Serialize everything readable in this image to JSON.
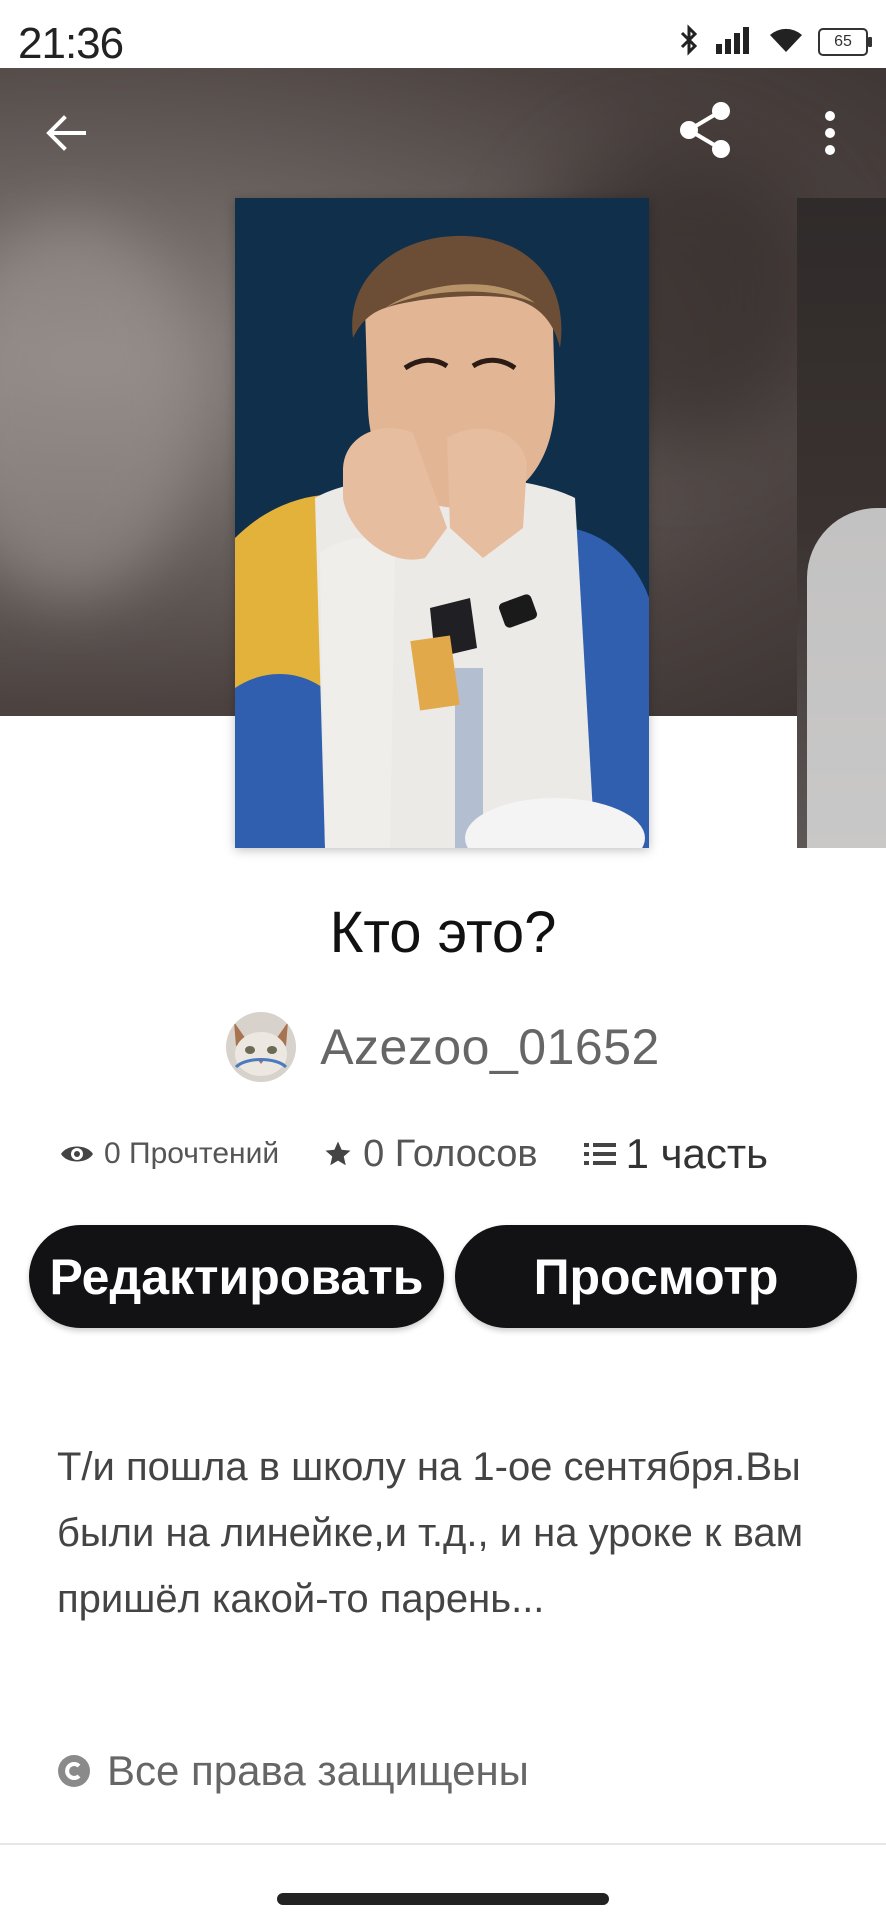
{
  "status_bar": {
    "time": "21:36",
    "battery": "65",
    "icons": [
      "bluetooth-icon",
      "signal-icon",
      "wifi-icon",
      "battery-icon"
    ]
  },
  "toolbar": {
    "icons": [
      "back-arrow-icon",
      "share-icon",
      "more-vert-icon"
    ]
  },
  "story": {
    "title": "Кто это?",
    "author": "Azezoo_01652",
    "stats": {
      "reads": "0 Прочтений",
      "votes": "0 Голосов",
      "parts": "1 часть"
    },
    "description": "Т/и пошла в школу на 1-ое сентября.Вы были на линейке,и т.д., и на уроке к вам пришёл какой-то парень...",
    "copyright": "Все права защищены"
  },
  "actions": {
    "edit_label": "Редактировать",
    "view_label": "Просмотр"
  },
  "colors": {
    "button_bg": "#121214",
    "button_text": "#ffffff",
    "muted_text": "#666666"
  }
}
